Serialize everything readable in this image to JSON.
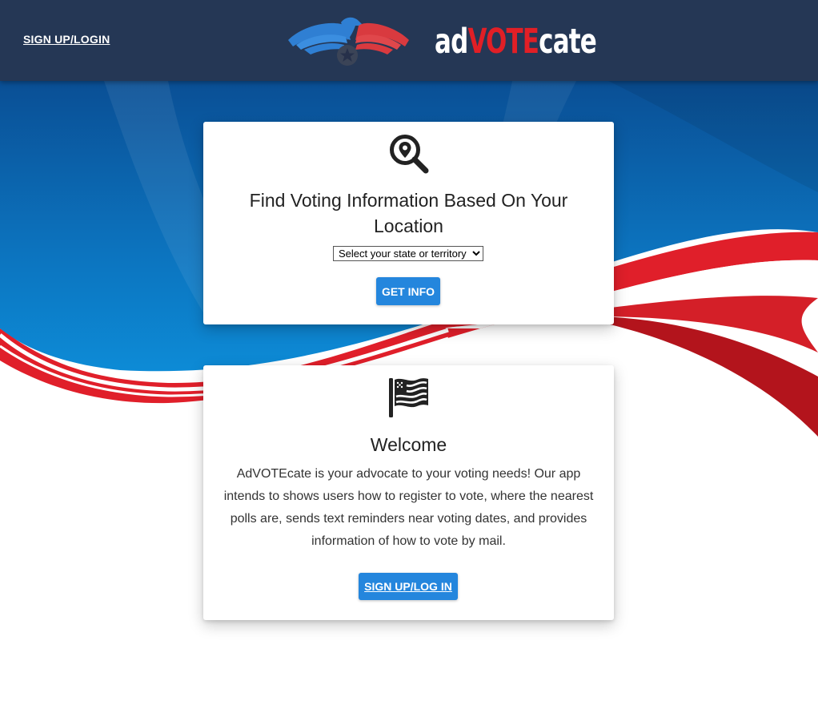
{
  "header": {
    "nav_link": "SIGN UP/LOGIN",
    "brand": {
      "part_a": "ad",
      "part_b": "VOTE",
      "part_c": "cate"
    }
  },
  "location_card": {
    "icon": "location-search-icon",
    "title": "Find Voting Information Based On Your Location",
    "select": {
      "selected": "Select your state or territory",
      "options": [
        "Select your state or territory"
      ]
    },
    "button_label": "GET INFO"
  },
  "welcome_card": {
    "icon": "flag-icon",
    "title": "Welcome",
    "body": "AdVOTEcate is your advocate to your voting needs! Our app intends to shows users how to register to vote, where the nearest polls are, sends text reminders near voting dates, and provides information of how to vote by mail.",
    "button_label": "SIGN UP/LOG IN"
  },
  "colors": {
    "navbar": "#253755",
    "brand_red": "#e11f26",
    "button_blue": "#2486dd",
    "background_blue": "#0b6fb5"
  }
}
